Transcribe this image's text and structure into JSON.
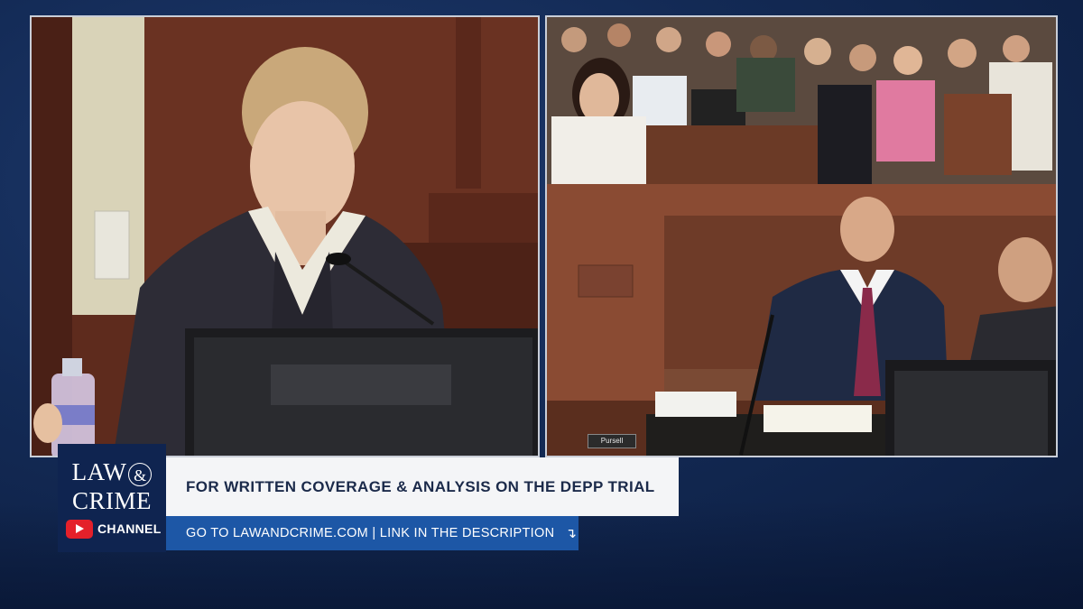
{
  "logo": {
    "line1": "LAW",
    "ampersand": "&",
    "line2": "CRIME",
    "channel_label": "CHANNEL",
    "youtube_icon": "youtube-play-icon"
  },
  "banner": {
    "headline": "FOR WRITTEN COVERAGE & ANALYSIS ON THE DEPP TRIAL",
    "subline": "GO TO LAWANDCRIME.COM | LINK IN THE DESCRIPTION",
    "arrow": "↴"
  },
  "desk_nameplate": "Pursell",
  "colors": {
    "background": "#132a55",
    "banner_light": "#f4f5f7",
    "banner_blue": "#1d57a6",
    "logo_box": "#0f2450",
    "youtube_red": "#e4202a"
  }
}
